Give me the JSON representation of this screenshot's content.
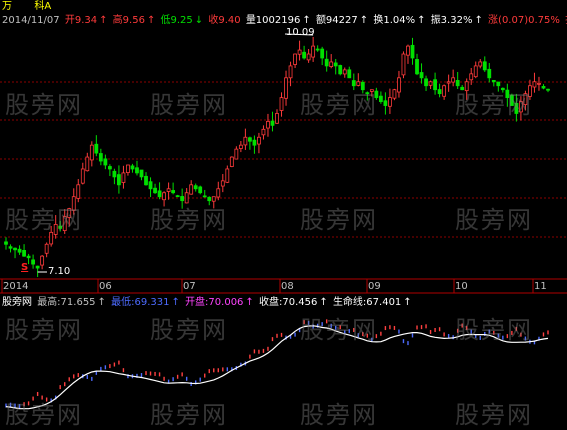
{
  "stock": {
    "name_parts": [
      "万",
      "科A"
    ]
  },
  "quote": {
    "date": "2014/11/07",
    "open": "开9.34",
    "high": "高9.56",
    "low": "低9.25",
    "close": "收9.40",
    "volume": "量1002196",
    "amount": "额94227",
    "turnover": "换1.04%",
    "amplitude": "振3.32%",
    "change": "涨(0.07)0.75%",
    "tail": "折"
  },
  "arrows": {
    "up": "↑",
    "down": "↓"
  },
  "annotations": {
    "high_mark": "10.09",
    "low_mark": "7.10",
    "buy_signal": "S"
  },
  "x_axis": {
    "labels": [
      "2014",
      "06",
      "07",
      "08",
      "09",
      "10",
      "11"
    ]
  },
  "indicator": {
    "name": "股旁网",
    "highest": "最高:71.655",
    "lowest": "最低:69.331",
    "open": "开盘:70.006",
    "close": "收盘:70.456",
    "lifeline": "生命线:67.401"
  },
  "watermark": "股旁网",
  "colors": {
    "up": "#ff3b3b",
    "down": "#00e000",
    "grid": "#8b0000",
    "lifeline": "#ffffff",
    "ind_red": "#ff4040",
    "ind_blue": "#4d6bff"
  },
  "chart_data": [
    {
      "type": "candlestick",
      "ylim": [
        7.1,
        10.09
      ],
      "marked_high": 10.09,
      "marked_low": 7.1,
      "x_labels": [
        "2014",
        "06",
        "07",
        "08",
        "09",
        "10",
        "11"
      ],
      "close": [
        7.45,
        7.4,
        7.38,
        7.35,
        7.3,
        7.28,
        7.2,
        7.15,
        7.3,
        7.45,
        7.6,
        7.7,
        7.65,
        7.8,
        7.9,
        8.05,
        8.2,
        8.4,
        8.55,
        8.7,
        8.6,
        8.5,
        8.45,
        8.4,
        8.3,
        8.2,
        8.35,
        8.45,
        8.4,
        8.35,
        8.3,
        8.2,
        8.15,
        8.1,
        8.05,
        8.1,
        8.15,
        8.1,
        8.05,
        8.0,
        8.1,
        8.2,
        8.15,
        8.1,
        8.05,
        8.0,
        8.05,
        8.15,
        8.25,
        8.4,
        8.55,
        8.65,
        8.7,
        8.8,
        8.75,
        8.7,
        8.8,
        8.9,
        9.0,
        8.95,
        9.1,
        9.3,
        9.55,
        9.7,
        9.85,
        9.9,
        9.8,
        9.85,
        9.95,
        9.9,
        9.8,
        9.7,
        9.75,
        9.7,
        9.6,
        9.65,
        9.55,
        9.45,
        9.5,
        9.4,
        9.35,
        9.4,
        9.3,
        9.25,
        9.2,
        9.3,
        9.4,
        9.55,
        9.85,
        9.95,
        9.8,
        9.6,
        9.55,
        9.45,
        9.5,
        9.4,
        9.35,
        9.45,
        9.5,
        9.55,
        9.45,
        9.4,
        9.5,
        9.6,
        9.7,
        9.75,
        9.65,
        9.55,
        9.5,
        9.45,
        9.4,
        9.3,
        9.2,
        9.1,
        9.25,
        9.35,
        9.45,
        9.5,
        9.48,
        9.42,
        9.4
      ]
    },
    {
      "type": "line",
      "series": [
        {
          "name": "生命线",
          "last": 67.401
        }
      ]
    }
  ]
}
